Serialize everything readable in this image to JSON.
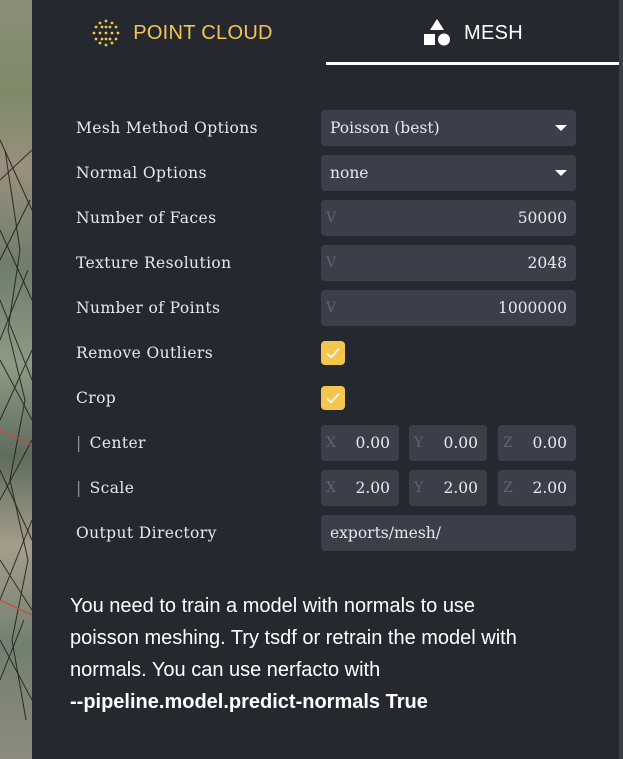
{
  "tabs": [
    {
      "label": "POINT CLOUD",
      "icon": "point-cloud-icon",
      "active": false,
      "color": "#f5c64f"
    },
    {
      "label": "MESH",
      "icon": "shapes-icon",
      "active": true,
      "color": "#ffffff"
    }
  ],
  "form": {
    "mesh_method": {
      "label": "Mesh Method Options",
      "value": "Poisson (best)"
    },
    "normal_options": {
      "label": "Normal Options",
      "value": "none"
    },
    "num_faces": {
      "label": "Number of Faces",
      "prefix": "V",
      "value": "50000"
    },
    "texture_resolution": {
      "label": "Texture Resolution",
      "prefix": "V",
      "value": "2048"
    },
    "num_points": {
      "label": "Number of Points",
      "prefix": "V",
      "value": "1000000"
    },
    "remove_outliers": {
      "label": "Remove Outliers",
      "checked": true
    },
    "crop": {
      "label": "Crop",
      "checked": true
    },
    "center": {
      "bar": "|",
      "label": "Center",
      "x": {
        "prefix": "X",
        "value": "0.00"
      },
      "y": {
        "prefix": "Y",
        "value": "0.00"
      },
      "z": {
        "prefix": "Z",
        "value": "0.00"
      }
    },
    "scale": {
      "bar": "|",
      "label": "Scale",
      "x": {
        "prefix": "X",
        "value": "2.00"
      },
      "y": {
        "prefix": "Y",
        "value": "2.00"
      },
      "z": {
        "prefix": "Z",
        "value": "2.00"
      }
    },
    "output_directory": {
      "label": "Output Directory",
      "value": "exports/mesh/"
    }
  },
  "notice": {
    "line1": "You need to train a model with normals to use",
    "line2": "poisson meshing. Try tsdf or retrain the model with",
    "line3": "normals. You can use nerfacto with",
    "command": "--pipeline.model.predict-normals True"
  },
  "colors": {
    "accent": "#f5c64f",
    "panel": "#25282f",
    "field": "#3a3f4a"
  }
}
